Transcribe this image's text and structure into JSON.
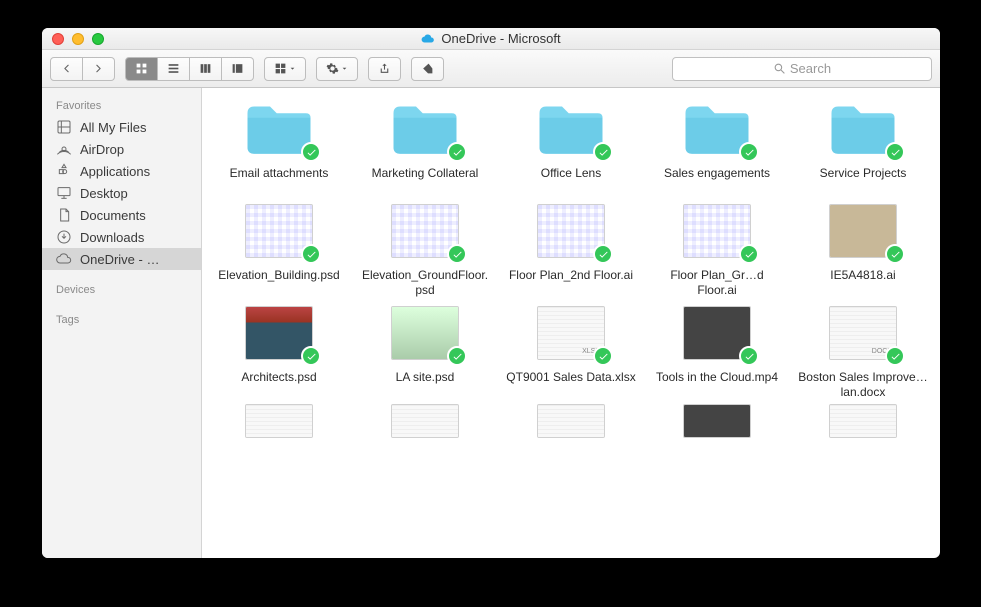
{
  "window": {
    "title": "OneDrive - Microsoft"
  },
  "toolbar": {
    "search_placeholder": "Search"
  },
  "sidebar": {
    "headings": {
      "favorites": "Favorites",
      "devices": "Devices",
      "tags": "Tags"
    },
    "items": [
      {
        "label": "All My Files",
        "icon": "all-my-files"
      },
      {
        "label": "AirDrop",
        "icon": "airdrop"
      },
      {
        "label": "Applications",
        "icon": "applications"
      },
      {
        "label": "Desktop",
        "icon": "desktop"
      },
      {
        "label": "Documents",
        "icon": "documents"
      },
      {
        "label": "Downloads",
        "icon": "downloads"
      },
      {
        "label": "OneDrive - …",
        "icon": "cloud",
        "selected": true
      }
    ]
  },
  "files": {
    "row1": [
      {
        "name": "Email attachments",
        "type": "folder"
      },
      {
        "name": "Marketing Collateral",
        "type": "folder"
      },
      {
        "name": "Office Lens",
        "type": "folder"
      },
      {
        "name": "Sales engagements",
        "type": "folder"
      },
      {
        "name": "Service Projects",
        "type": "folder"
      }
    ],
    "row2": [
      {
        "name": "Elevation_Building.psd",
        "type": "file",
        "preview": "plan"
      },
      {
        "name": "Elevation_GroundFloor.psd",
        "type": "file",
        "preview": "plan"
      },
      {
        "name": "Floor Plan_2nd Floor.ai",
        "type": "file",
        "preview": "plan"
      },
      {
        "name": "Floor Plan_Gr…d Floor.ai",
        "type": "file",
        "preview": "plan"
      },
      {
        "name": "IE5A4818.ai",
        "type": "file",
        "preview": "photo"
      }
    ],
    "row3": [
      {
        "name": "Architects.psd",
        "type": "file",
        "preview": "photo3"
      },
      {
        "name": "LA site.psd",
        "type": "file",
        "preview": "photo4"
      },
      {
        "name": "QT9001 Sales Data.xlsx",
        "type": "file",
        "preview": "sheet",
        "ext": "XLSX"
      },
      {
        "name": "Tools in the Cloud.mp4",
        "type": "file",
        "preview": "photo2"
      },
      {
        "name": "Boston Sales Improve…lan.docx",
        "type": "file",
        "preview": "sheet",
        "ext": "DOCX"
      }
    ],
    "row4": [
      {
        "name": "",
        "type": "file",
        "preview": "sheet"
      },
      {
        "name": "",
        "type": "file",
        "preview": "sheet"
      },
      {
        "name": "",
        "type": "file",
        "preview": "sheet"
      },
      {
        "name": "",
        "type": "file",
        "preview": "photo2"
      },
      {
        "name": "",
        "type": "file",
        "preview": "sheet"
      }
    ]
  }
}
